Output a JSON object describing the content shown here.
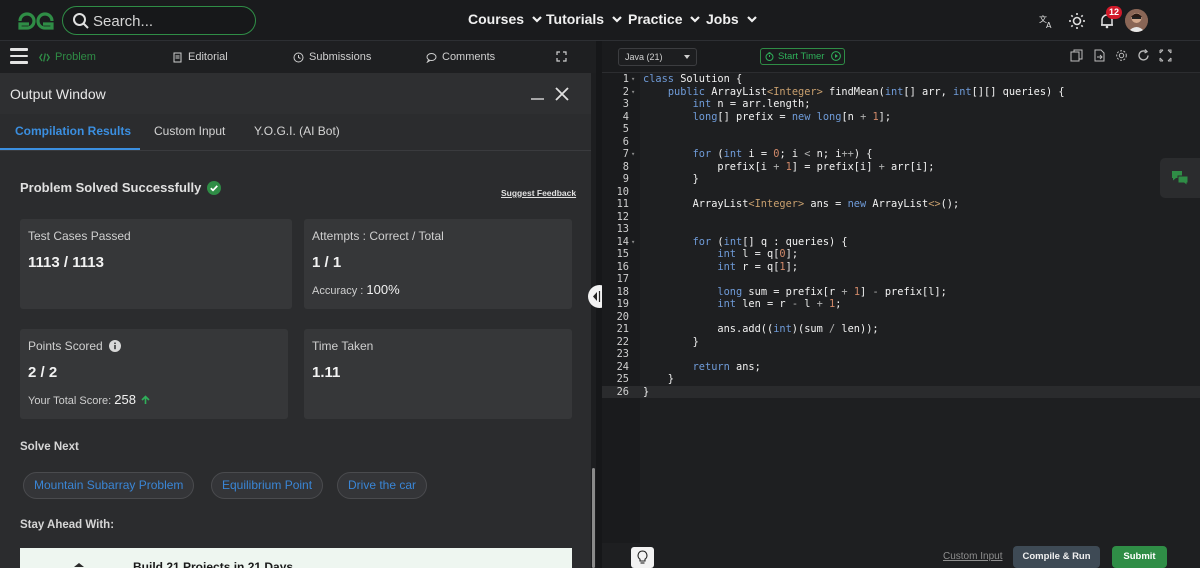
{
  "nav": {
    "search_placeholder": "Search...",
    "menus": [
      "Courses",
      "Tutorials",
      "Practice",
      "Jobs"
    ],
    "notification_count": "12"
  },
  "left_tabs": [
    "Problem",
    "Editorial",
    "Submissions",
    "Comments"
  ],
  "output": {
    "title": "Output Window",
    "tabs": [
      "Compilation Results",
      "Custom Input",
      "Y.O.G.I. (AI Bot)"
    ],
    "status": "Problem Solved Successfully",
    "feedback": "Suggest Feedback",
    "cards": {
      "tests_label": "Test Cases Passed",
      "tests_value": "1113 / 1113",
      "attempts_label": "Attempts : Correct / Total",
      "attempts_value": "1 / 1",
      "accuracy_label": "Accuracy :",
      "accuracy_value": "100%",
      "points_label": "Points Scored",
      "points_value": "2 / 2",
      "total_label": "Your Total Score:",
      "total_value": "258",
      "time_label": "Time Taken",
      "time_value": "1.11"
    },
    "solve_next": "Solve Next",
    "chips": [
      "Mountain Subarray Problem",
      "Equilibrium Point",
      "Drive the car"
    ],
    "stay_ahead": "Stay Ahead With:",
    "promo": "Build 21 Projects in 21 Days"
  },
  "editor": {
    "language": "Java (21)",
    "timer": "Start Timer",
    "custom_input": "Custom Input",
    "compile": "Compile & Run",
    "submit": "Submit",
    "code_lines": [
      "class Solution {",
      "    public ArrayList<Integer> findMean(int[] arr, int[][] queries) {",
      "        int n = arr.length;",
      "        long[] prefix = new long[n + 1];",
      "",
      "",
      "        for (int i = 0; i < n; i++) {",
      "            prefix[i + 1] = prefix[i] + arr[i];",
      "        }",
      "",
      "        ArrayList<Integer> ans = new ArrayList<>();",
      "",
      "",
      "        for (int[] q : queries) {",
      "            int l = q[0];",
      "            int r = q[1];",
      "",
      "            long sum = prefix[r + 1] - prefix[l];",
      "            int len = r - l + 1;",
      "",
      "            ans.add((int)(sum / len));",
      "        }",
      "",
      "        return ans;",
      "    }",
      "}"
    ]
  }
}
